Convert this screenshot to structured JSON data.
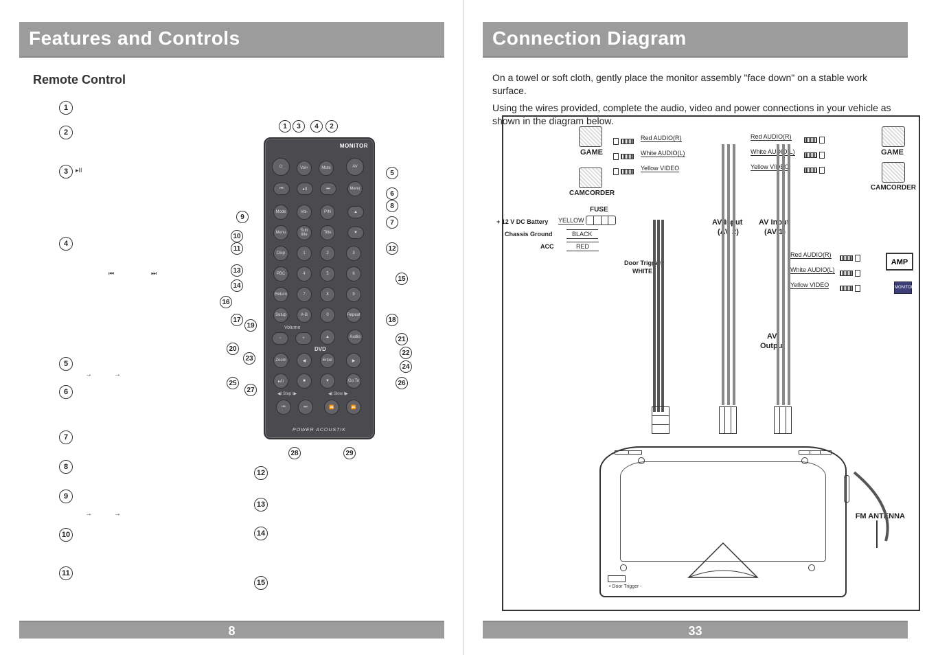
{
  "left_page": {
    "title": "Features and Controls",
    "subtitle": "Remote Control",
    "remote_label": "MONITOR",
    "brand": "POWER ACOUSTIK",
    "buttons": {
      "power": "⏻",
      "vol_plus": "Vol+",
      "mute": "Mute",
      "av": "AV",
      "prev": "⏮",
      "play_pause": "▸II",
      "next": "⏭",
      "menu": "Menu",
      "mode": "Mode",
      "vol_minus": "Vol-",
      "pn": "P/N",
      "up": "▲",
      "dvd_menu": "Menu",
      "sub_title": "Sub title",
      "title": "Title",
      "down": "▼",
      "disp": "Disp",
      "n1": "1",
      "n2": "2",
      "n3": "3",
      "pbc": "PBC",
      "n4": "4",
      "n5": "5",
      "n6": "6",
      "return": "Return",
      "n7": "7",
      "n8": "8",
      "n9": "9",
      "setup": "Setup",
      "ab": "A-B",
      "n0": "0",
      "repeat": "Repeat",
      "vol_label": "Volume",
      "minus": "−",
      "plus": "+",
      "nav_up": "▲",
      "audio": "Audio",
      "dvd_label": "DVD",
      "zoom": "Zoom",
      "left": "◀",
      "enter": "Enter",
      "right": "▶",
      "play2": "▸/II",
      "stop": "■",
      "nav_down": "▼",
      "goto": "Go To",
      "step_l": "◀I Step I▶",
      "slow_l": "◀I Slow I▶",
      "rw": "⏮",
      "ff": "⏭",
      "rw2": "⏪",
      "ff2": "⏩"
    },
    "callouts_top": [
      "1",
      "3",
      "4",
      "2"
    ],
    "callouts_left": [
      "1",
      "2",
      "3",
      "4",
      "5",
      "6",
      "7",
      "8",
      "9",
      "10",
      "11"
    ],
    "callouts_left_mid": [
      "9",
      "10",
      "11",
      "13",
      "14",
      "16",
      "17",
      "19",
      "20",
      "23",
      "25",
      "27"
    ],
    "callouts_right": [
      "5",
      "6",
      "8",
      "7",
      "12",
      "15",
      "18",
      "21",
      "22",
      "24",
      "26"
    ],
    "callouts_bottom": [
      "28",
      "29"
    ],
    "callouts_lower": [
      "12",
      "13",
      "14",
      "15"
    ],
    "glyphs": {
      "play": "▸II",
      "prev": "⏮",
      "next": "⏭",
      "arrow": "→"
    },
    "page_number": "8"
  },
  "right_page": {
    "title": "Connection Diagram",
    "intro1": "On a towel or soft cloth, gently place the monitor assembly \"face down\" on a stable work surface.",
    "intro2": "Using the wires provided, complete the audio, video and power connections in your vehicle as shown in the diagram below.",
    "labels": {
      "game_l": "GAME",
      "camcorder_l": "CAMCORDER",
      "game_r": "GAME",
      "camcorder_r": "CAMCORDER",
      "red_audio_r": "Red AUDIO(R)",
      "white_audio_l": "White AUDIO(L)",
      "yellow_video": "Yellow VIDEO",
      "red_audio_r2": "Red AUDIO(R)",
      "white_audio_l2": "White AUDIO(L)",
      "yellow_video2": "Yellow VIDEO",
      "red_audio_r3": "Red AUDIO(R)",
      "white_audio_l3": "White AUDIO(L)",
      "yellow_video3": "Yellow VIDEO",
      "fuse": "FUSE",
      "battery": "+ 12 V DC Battery",
      "yellow": "YELLOW",
      "chassis": "Chassis Ground",
      "black": "BLACK",
      "acc": "ACC",
      "red": "RED",
      "door_trigger": "Door Trigger",
      "white": "WHITE",
      "av_in2": "AV Input",
      "av_in2b": "(AV 2)",
      "av_in1": "AV Input",
      "av_in1b": "(AV 1)",
      "amp": "AMP",
      "monitor": "MONITOR",
      "av_out": "AV",
      "av_out2": "Output",
      "fm_antenna": "FM ANTENNA",
      "door_trigger_unit": "• Door Trigger -"
    },
    "page_number": "33"
  }
}
